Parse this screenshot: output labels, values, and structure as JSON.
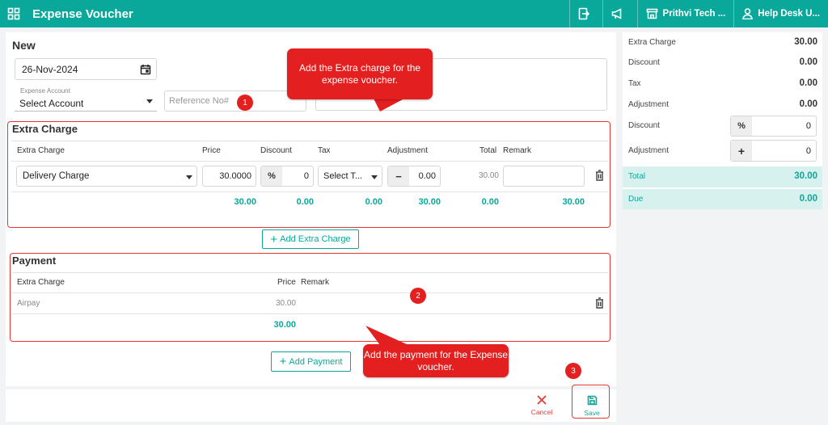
{
  "header": {
    "title": "Expense Voucher",
    "company": "Prithvi Tech ...",
    "user": "Help Desk U..."
  },
  "form": {
    "heading": "New",
    "date": "26-Nov-2024",
    "expense_account_label": "Expense Account",
    "expense_account_value": "Select Account",
    "reference_placeholder": "Reference No#"
  },
  "extra_charge": {
    "title": "Extra Charge",
    "columns": [
      "Extra Charge",
      "Price",
      "Discount",
      "Tax",
      "Adjustment",
      "Total",
      "Remark"
    ],
    "row": {
      "charge": "Delivery Charge",
      "price": "30.0000",
      "discount_type": "%",
      "discount": "0",
      "tax": "Select T...",
      "adjust_sign": "−",
      "adjustment": "0.00",
      "total": "30.00"
    },
    "totals": {
      "price": "30.00",
      "discount": "0.00",
      "tax": "0.00",
      "adjustment": "30.00",
      "total": "0.00",
      "remark": "30.00"
    },
    "add_button": "Add Extra Charge"
  },
  "payment": {
    "title": "Payment",
    "columns": [
      "Extra Charge",
      "Price",
      "Remark"
    ],
    "row": {
      "name": "Airpay",
      "price": "30.00"
    },
    "total": "30.00",
    "add_button": "Add Payment"
  },
  "summary": {
    "rows": [
      {
        "label": "Extra Charge",
        "value": "30.00"
      },
      {
        "label": "Discount",
        "value": "0.00"
      },
      {
        "label": "Tax",
        "value": "0.00"
      },
      {
        "label": "Adjustment",
        "value": "0.00"
      }
    ],
    "discount_label": "Discount",
    "discount_type": "%",
    "discount_value": "0",
    "adjustment_label": "Adjustment",
    "adjustment_sign": "+",
    "adjustment_value": "0",
    "total_label": "Total",
    "total_value": "30.00",
    "due_label": "Due",
    "due_value": "0.00"
  },
  "actions": {
    "cancel": "Cancel",
    "save": "Save"
  },
  "callouts": {
    "extra": "Add the Extra charge for the expense voucher.",
    "payment": "Add the payment for the Expense voucher.",
    "badge1": "1",
    "badge2": "2",
    "badge3": "3"
  },
  "colors": {
    "teal": "#0aa89a",
    "red": "#e41f1f"
  }
}
